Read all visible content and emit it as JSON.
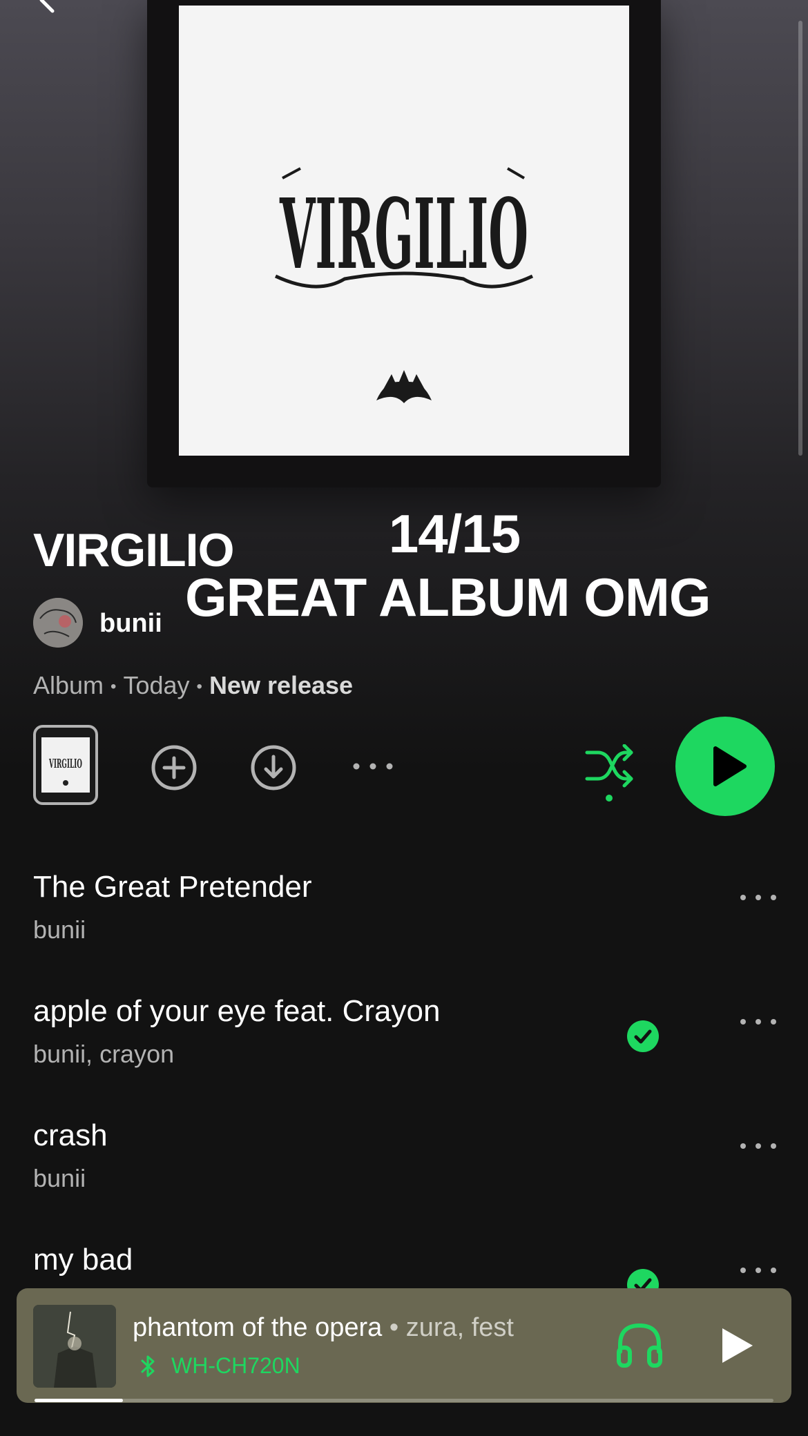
{
  "colors": {
    "accent": "#1ed760",
    "background": "#121212",
    "secondary_text": "#b3b3b3",
    "mini_player_bg": "#6a6852"
  },
  "header": {
    "back_icon": "chevron-left-icon"
  },
  "album": {
    "cover_text": "VIRGILIO",
    "title": "VIRGILIO",
    "artist": "bunii",
    "type": "Album",
    "date": "Today",
    "badge": "New release"
  },
  "overlay": {
    "score": "14/15",
    "caption": "GREAT ALBUM OMG"
  },
  "controls": {
    "icons": [
      "add-circle-icon",
      "download-circle-icon",
      "more-icon",
      "shuffle-icon",
      "play-icon"
    ],
    "shuffle_active": true
  },
  "tracks": [
    {
      "title": "The Great Pretender",
      "artist": "bunii",
      "downloaded": false
    },
    {
      "title": "apple of your eye feat. Crayon",
      "artist": "bunii, crayon",
      "downloaded": true
    },
    {
      "title": "crash",
      "artist": "bunii",
      "downloaded": false
    },
    {
      "title": "my bad",
      "artist": "",
      "downloaded": true
    }
  ],
  "now_playing": {
    "title": "phantom of the opera",
    "separator": " • ",
    "artist": "zura, fest",
    "device": "WH-CH720N",
    "progress": 0.12
  }
}
